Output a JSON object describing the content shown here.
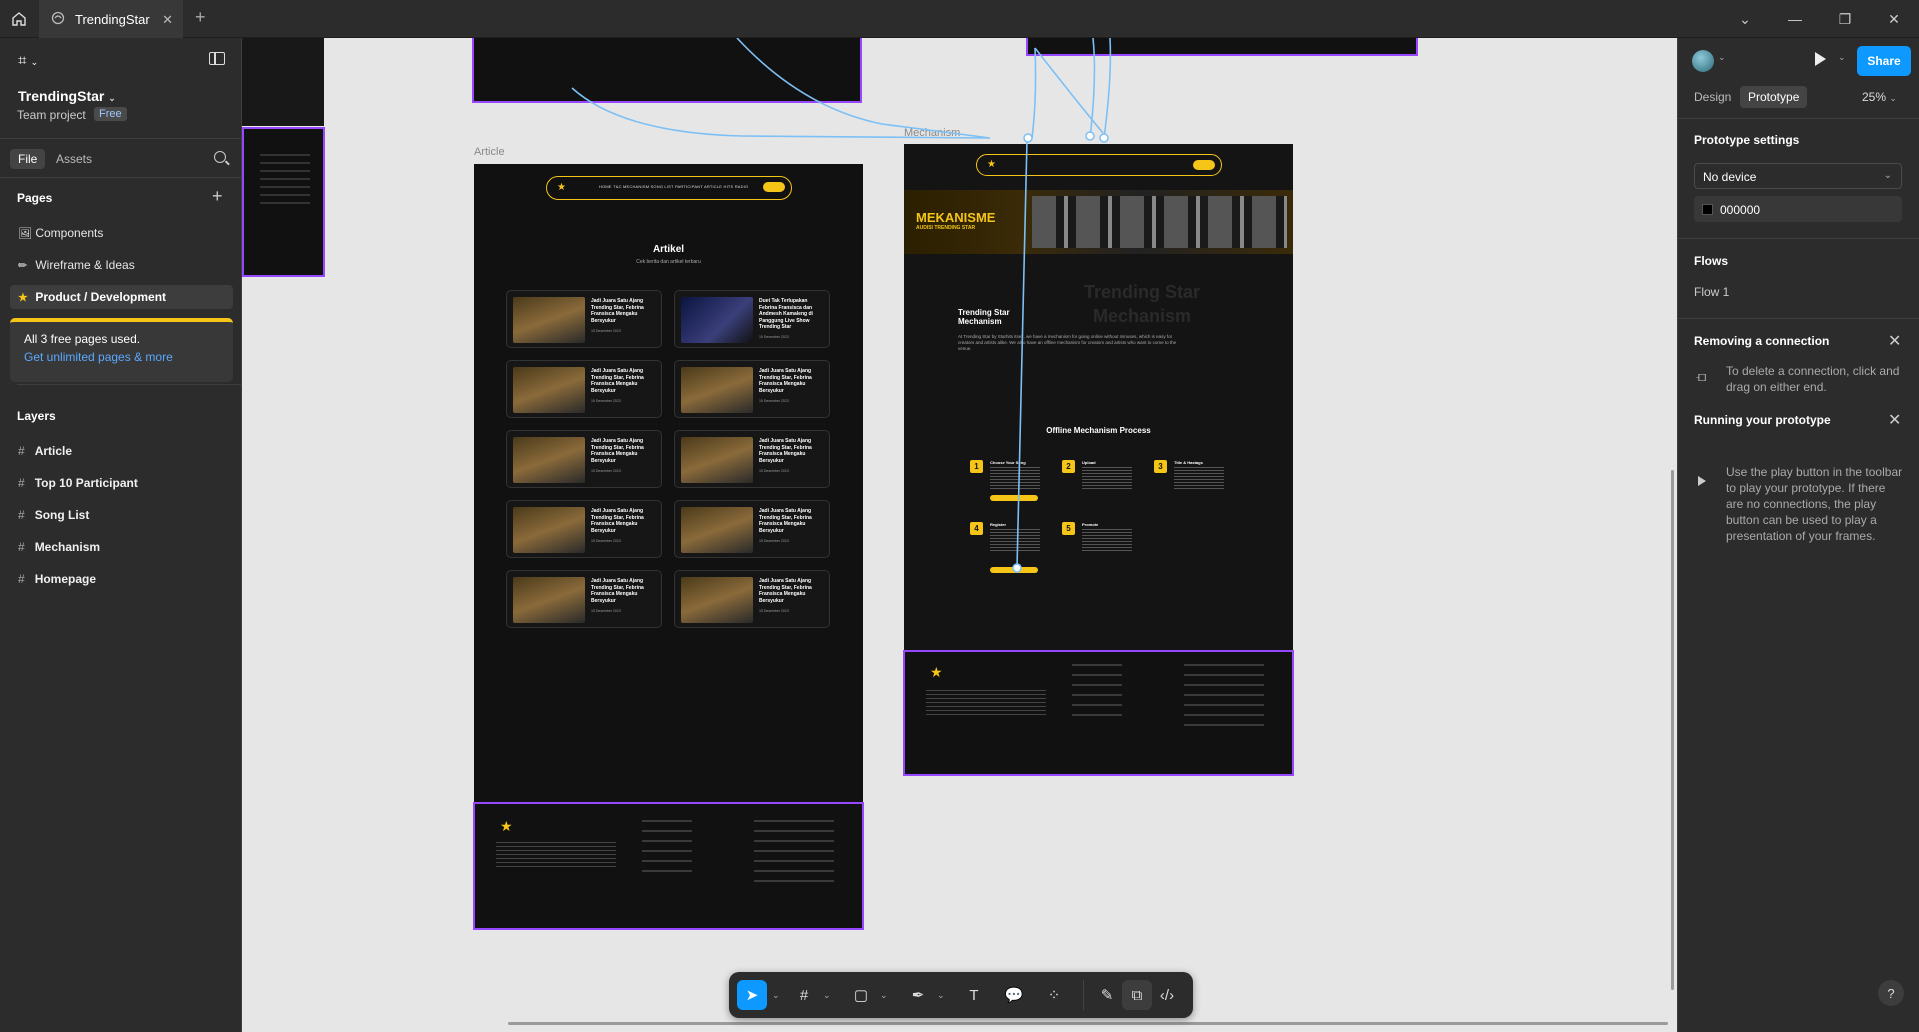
{
  "titlebar": {
    "tab_title": "TrendingStar",
    "colors": {
      "bg": "#2c2c2c",
      "tab_bg": "#383838"
    }
  },
  "left_panel": {
    "project_name": "TrendingStar",
    "team_label": "Team project",
    "plan_badge": "Free",
    "tabs": [
      "File",
      "Assets"
    ],
    "pages_header": "Pages",
    "pages": [
      {
        "icon": "image-icon",
        "label": "Components"
      },
      {
        "icon": "pencil-icon",
        "label": "Wireframe & Ideas"
      },
      {
        "icon": "star-icon",
        "label": "Product / Development"
      }
    ],
    "notice_text": "All 3 free pages used.",
    "notice_link": "Get unlimited pages & more",
    "layers_header": "Layers",
    "layers": [
      "Article",
      "Top 10 Participant",
      "Song List",
      "Mechanism",
      "Homepage"
    ]
  },
  "canvas": {
    "frame_labels": [
      "Article",
      "Mechanism"
    ],
    "article": {
      "heading": "Artikel",
      "subheading": "Cek berita dan artikel terbaru",
      "cards": [
        "Jadi Juara Satu Ajang Trending Star, Febrina Fransisca Mengaku Bersyukur",
        "Duet Tak Terlupakan Febrina Fransisca dan Andmesh Kamaleng di Panggung Live Show Trending Star",
        "Jadi Juara Satu Ajang Trending Star, Febrina Fransisca Mengaku Bersyukur",
        "Jadi Juara Satu Ajang Trending Star, Febrina Fransisca Mengaku Bersyukur",
        "Jadi Juara Satu Ajang Trending Star, Febrina Fransisca Mengaku Bersyukur",
        "Jadi Juara Satu Ajang Trending Star, Febrina Fransisca Mengaku Bersyukur",
        "Jadi Juara Satu Ajang Trending Star, Febrina Fransisca Mengaku Bersyukur",
        "Jadi Juara Satu Ajang Trending Star, Febrina Fransisca Mengaku Bersyukur",
        "Jadi Juara Satu Ajang Trending Star, Febrina Fransisca Mengaku Bersyukur",
        "Jadi Juara Satu Ajang Trending Star, Febrina Fransisca Mengaku Bersyukur"
      ],
      "card_date": "15 Desember 2023",
      "second_card_date": "15 Desember 2023",
      "nav": [
        "HOME",
        "T&C",
        "MECHANISM",
        "SONG LIST",
        "PARTICIPANT",
        "ARTICLE",
        "HITS RADIO"
      ]
    },
    "mechanism": {
      "banner_title": "MEKANISME",
      "banner_sub": "AUDISI TRENDING STAR",
      "section_title": "Trending Star Mechanism",
      "bg_text": "Trending Star Mechanism",
      "section_body": "At Trending Star by Starhits itself, we have a mechanism for going online without minuses, which is easy for creators and artists alike. We also have an offline mechanism for creators and artists who want to come to the venue.",
      "offline_title": "Offline Mechanism Process",
      "steps": [
        {
          "num": "1",
          "title": "Choose Your Song"
        },
        {
          "num": "2",
          "title": "Upload"
        },
        {
          "num": "3",
          "title": "Title & Hastags"
        },
        {
          "num": "4",
          "title": "Register"
        },
        {
          "num": "5",
          "title": "Promote"
        }
      ]
    }
  },
  "right_panel": {
    "share_label": "Share",
    "tabs": [
      "Design",
      "Prototype"
    ],
    "zoom": "25%",
    "prototype_settings": "Prototype settings",
    "device": "No device",
    "bg_color": "000000",
    "flows_header": "Flows",
    "flow_item": "Flow 1",
    "removing_header": "Removing a connection",
    "removing_text": "To delete a connection, click and drag on either end.",
    "running_header": "Running your prototype",
    "running_text": "Use the play button in the toolbar to play your prototype. If there are no connections, the play button can be used to play a presentation of your frames.",
    "help": "?"
  },
  "accent": {
    "blue": "#0d99ff",
    "purple": "#9747ff",
    "yellow": "#f5c518"
  }
}
